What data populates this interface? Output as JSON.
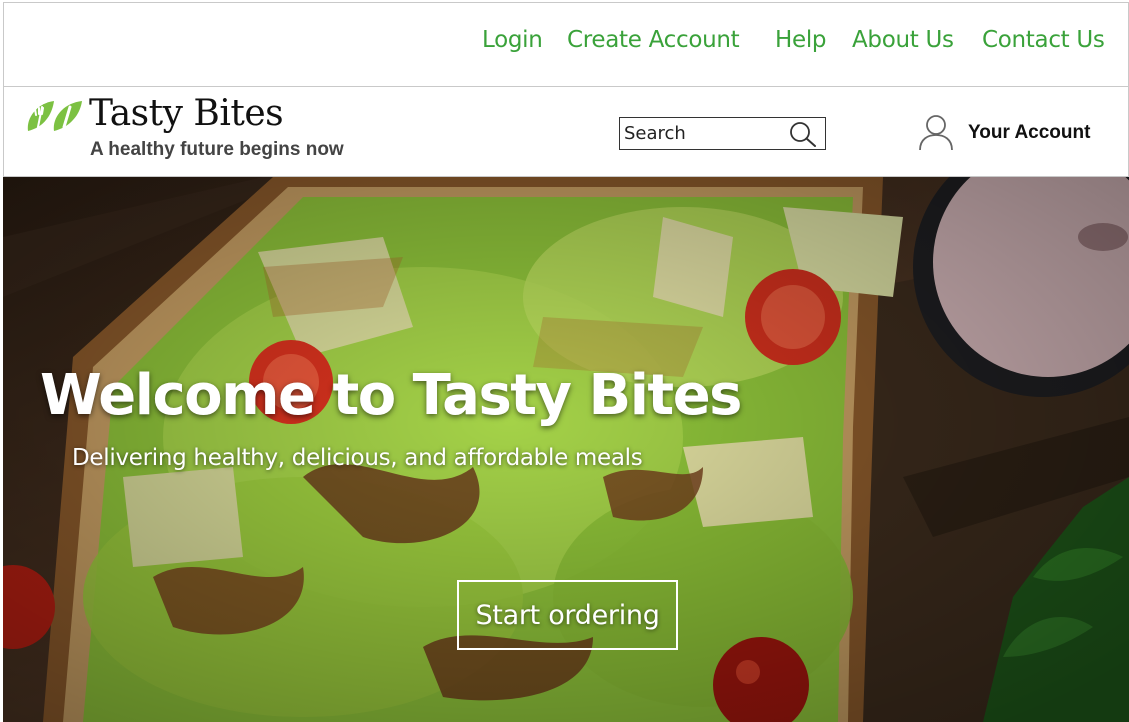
{
  "top_nav": {
    "login": "Login",
    "create_account": "Create Account",
    "help": "Help",
    "about_us": "About Us",
    "contact_us": "Contact Us",
    "link_color": "#3aa23a"
  },
  "header": {
    "brand_name": "Tasty Bites",
    "tagline": "A healthy future begins now",
    "logo_icon": "leaf-fork-icon",
    "logo_color": "#7cc142",
    "search": {
      "placeholder": "Search",
      "value": "",
      "icon": "search-icon"
    },
    "account": {
      "label": "Your Account",
      "icon": "user-icon"
    }
  },
  "hero": {
    "title": "Welcome to Tasty Bites",
    "subtitle": "Delivering healthy, delicious, and affordable meals",
    "cta_label": "Start ordering",
    "background": "avocado-toast-photo"
  }
}
